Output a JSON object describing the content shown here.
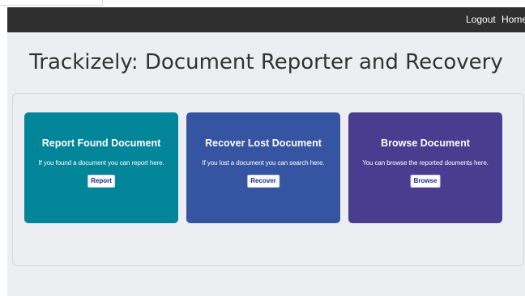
{
  "navbar": {
    "logout_label": "Logout",
    "home_label": "Home"
  },
  "page": {
    "title": "Trackizely: Document Reporter and Recovery"
  },
  "cards": [
    {
      "title": "Report Found Document",
      "text": "If you found a document you can report here.",
      "button": "Report",
      "color": "#028599"
    },
    {
      "title": "Recover Lost Document",
      "text": "If you lost a document you can search here.",
      "button": "Recover",
      "color": "#3554a1"
    },
    {
      "title": "Browse Document",
      "text": "You can browse the reported douments here.",
      "button": "Browse",
      "color": "#4a3c8f"
    }
  ]
}
